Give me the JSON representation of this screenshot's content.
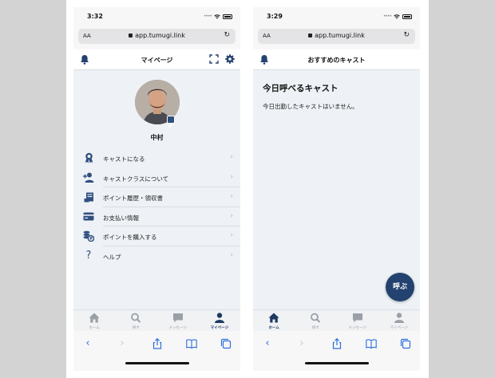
{
  "colors": {
    "accent": "#23426f",
    "icon": "#2f4f7f",
    "link_blue": "#2f6fde",
    "content_bg": "#eef2f6",
    "outer_bg": "#d3d3d3"
  },
  "left_screen": {
    "status": {
      "time": "3:32"
    },
    "url": {
      "aa": "AA",
      "domain": "app.tumugi.link"
    },
    "header": {
      "title": "マイページ",
      "left_icon": "bell-icon",
      "right_icons": [
        "scan-icon",
        "gear-icon"
      ]
    },
    "profile": {
      "name": "中村"
    },
    "menu": [
      {
        "label": "キャストになる",
        "icon": "badge-icon"
      },
      {
        "label": "キャストクラスについて",
        "icon": "user-plus-icon"
      },
      {
        "label": "ポイント履歴・領収書",
        "icon": "receipt-icon"
      },
      {
        "label": "お支払い情報",
        "icon": "credit-card-icon"
      },
      {
        "label": "ポイントを購入する",
        "icon": "coins-icon"
      },
      {
        "label": "ヘルプ",
        "icon": "question-icon"
      }
    ],
    "tabs": [
      {
        "label": "ホーム",
        "icon": "home-icon",
        "active": false
      },
      {
        "label": "探す",
        "icon": "search-icon",
        "active": false
      },
      {
        "label": "メッセージ",
        "icon": "message-icon",
        "active": false
      },
      {
        "label": "マイページ",
        "icon": "user-icon",
        "active": true
      }
    ]
  },
  "right_screen": {
    "status": {
      "time": "3:29"
    },
    "url": {
      "aa": "AA",
      "domain": "app.tumugi.link"
    },
    "header": {
      "title": "おすすめのキャスト",
      "left_icon": "bell-icon"
    },
    "section_title": "今日呼べるキャスト",
    "empty_message": "今日出勤したキャストはいません。",
    "fab_label": "呼ぶ",
    "tabs": [
      {
        "label": "ホーム",
        "icon": "home-icon",
        "active": true
      },
      {
        "label": "探す",
        "icon": "search-icon",
        "active": false
      },
      {
        "label": "メッセージ",
        "icon": "message-icon",
        "active": false
      },
      {
        "label": "マイページ",
        "icon": "user-icon",
        "active": false
      }
    ]
  },
  "browser_toolbar": [
    "back-icon",
    "forward-icon",
    "share-icon",
    "bookmarks-icon",
    "tabs-icon"
  ]
}
